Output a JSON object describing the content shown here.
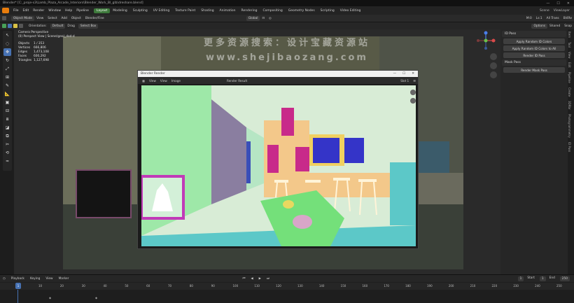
{
  "window": {
    "title": "Blender* [C:_proje-s3\\Lamb_Plaza_Arcade_Interiors\\Blender_Work_Bl_glb\\dreshare.blend]"
  },
  "menu": {
    "items": [
      "File",
      "Edit",
      "Render",
      "Window",
      "Help",
      "Pipeline"
    ],
    "workspaces": [
      "Layout",
      "Modeling",
      "Sculpting",
      "UV Editing",
      "Texture Paint",
      "Shading",
      "Animation",
      "Rendering",
      "Compositing",
      "Geometry Nodes",
      "Scripting",
      "Video Editing"
    ],
    "active_workspace": "Layout",
    "right": [
      "Scene",
      "ViewLayer"
    ]
  },
  "header1": {
    "mode": "Object Mode",
    "items": [
      "View",
      "Select",
      "Add",
      "Object"
    ],
    "transform": "Global",
    "pivot": "Blender/Fine",
    "right": [
      "M:0",
      "Ls:1",
      "All Trans",
      "Bl4Re"
    ]
  },
  "header2": {
    "orientation": "Default",
    "drag": "Drag",
    "select": "Select Box",
    "options": "Options",
    "right": [
      "Shared",
      "Snap"
    ]
  },
  "viewport": {
    "camera": "Camera Perspective",
    "collection": "(0) Perspect View | Scene(geo)_dod-d",
    "stats": [
      {
        "label": "Objects",
        "value": "1 / 353"
      },
      {
        "label": "Vertices",
        "value": "666,806"
      },
      {
        "label": "Edges",
        "value": "1,473,108"
      },
      {
        "label": "Faces",
        "value": "600,292"
      },
      {
        "label": "Triangles",
        "value": "1,127,698"
      }
    ]
  },
  "watermark": {
    "line1": "更多资源搜索：设计宝藏资源站",
    "line2": "www.shejibaozang.com"
  },
  "npanel": {
    "section1": "ID Pass",
    "buttons1": [
      "Apply Random ID Colors",
      "Apply Random ID Colors to All",
      "Render ID Pass"
    ],
    "section2": "Mask Pass",
    "buttons2": [
      "Render Mask Pass"
    ],
    "tabs": [
      "Item",
      "Tool",
      "View",
      "Edit",
      "Pipeline",
      "Create",
      "3DRbr",
      "Photogrammetry",
      "ID Pass"
    ]
  },
  "render_window": {
    "title": "Blender Render",
    "header": [
      "View",
      "View",
      "Image"
    ],
    "slot": "Slot 1",
    "layer": "Render Result"
  },
  "timeline": {
    "header": [
      "Playback",
      "Keying",
      "View",
      "Marker"
    ],
    "current_frame": "1",
    "start_label": "Start",
    "start": "1",
    "end_label": "End",
    "end": "250",
    "ticks": [
      "10",
      "20",
      "30",
      "40",
      "50",
      "60",
      "70",
      "80",
      "90",
      "100",
      "110",
      "120",
      "130",
      "140",
      "150",
      "160",
      "170",
      "180",
      "190",
      "200",
      "210",
      "220",
      "230",
      "240",
      "250"
    ]
  }
}
